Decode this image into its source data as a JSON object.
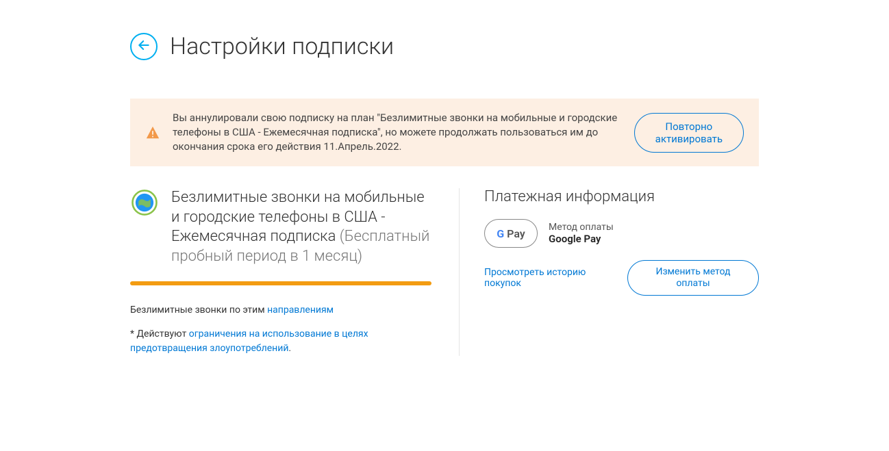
{
  "header": {
    "title": "Настройки подписки"
  },
  "alert": {
    "text": "Вы аннулировали свою подписку на план \"Безлимитные звонки на мобильные и городские телефоны в США - Ежемесячная подписка\", но можете продолжать пользоваться им до окончания срока его действия 11.Апрель.2022.",
    "reactivate_label": "Повторно активировать"
  },
  "plan": {
    "title_main": "Безлимитные звонки на мобильные и городские телефоны в США - Ежемесячная подписка",
    "title_trial": " (Бесплатный пробный период в 1 месяц)",
    "desc_prefix": "Безлимитные звонки по этим ",
    "desc_link": "направлениям",
    "note_prefix": "* Действуют ",
    "note_link": "ограничения на использование в целях предотвращения злоупотреблений",
    "note_suffix": "."
  },
  "payment": {
    "section_title": "Платежная информация",
    "method_label": "Метод оплаты",
    "method_value": "Google Pay",
    "history_link": "Просмотреть историю покупок",
    "change_button": "Изменить метод оплаты",
    "gpay_text": "Pay"
  }
}
